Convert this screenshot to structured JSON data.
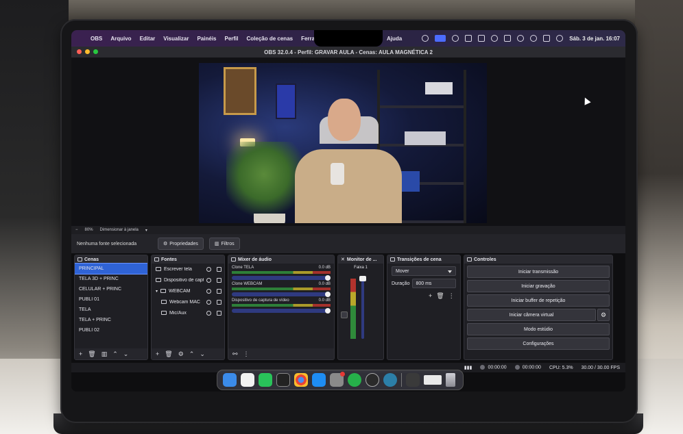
{
  "menubar": {
    "items": [
      "OBS",
      "Arquivo",
      "Editar",
      "Visualizar",
      "Painéis",
      "Perfil",
      "Coleção de cenas",
      "Ferramentas"
    ],
    "help": "Ajuda",
    "clock": "Sáb. 3 de jan.  16:07"
  },
  "window": {
    "title": "OBS 32.0.4 - Perfil: GRAVAR AULA - Cenas: AULA MAGNÉTICA 2"
  },
  "zoom": {
    "level": "80%",
    "mode": "Dimensionar à janela"
  },
  "source_bar": {
    "no_source": "Nenhuma fonte selecionada",
    "properties": "Propriedades",
    "filters": "Filtros"
  },
  "scenes": {
    "title": "Cenas",
    "items": [
      "PRINCIPAL",
      "TELA 3D + PRINC",
      "CELULAR + PRINC",
      "PUBLI 01",
      "TELA",
      "TELA + PRINC",
      "PUBLI 02"
    ],
    "selected_index": 0
  },
  "sources": {
    "title": "Fontes",
    "items": [
      "Escrever tela",
      "Dispositivo de captu",
      "WEBCAM",
      "Webcam MAC",
      "Mic/Aux"
    ]
  },
  "mixer": {
    "title": "Mixer de áudio",
    "channels": [
      {
        "name": "Clone TELA",
        "db": "0.0 dB"
      },
      {
        "name": "Clone WEBCAM",
        "db": "0.0 dB"
      },
      {
        "name": "Dispositivo de captura de vídeo",
        "db": "0.0 dB"
      }
    ]
  },
  "monitor": {
    "title": "Monitor de ...",
    "track": "Faixa 1"
  },
  "transitions": {
    "title": "Transições de cena",
    "selected": "Mover",
    "duration_label": "Duração",
    "duration_value": "800 ms"
  },
  "controls": {
    "title": "Controles",
    "buttons": [
      "Iniciar transmissão",
      "Iniciar gravação",
      "Iniciar buffer de repetição",
      "Iniciar câmera virtual",
      "Modo estúdio",
      "Configurações"
    ]
  },
  "statusbar": {
    "stream_time": "00:00:00",
    "rec_time": "00:00:00",
    "cpu": "CPU: 5.3%",
    "fps": "30.00 / 30.00 FPS"
  },
  "colors": {
    "accent": "#2f63d6",
    "dock_bg": "#1f1f24",
    "panel_header": "#2a2a30"
  }
}
